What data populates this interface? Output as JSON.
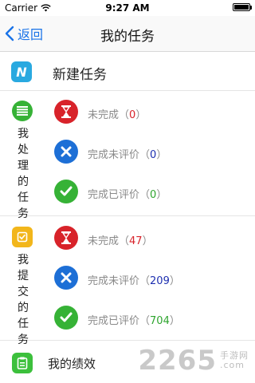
{
  "status_bar": {
    "carrier": "Carrier",
    "time": "9:27 AM",
    "battery_level": 1.0
  },
  "nav": {
    "back_label": "返回",
    "title": "我的任务"
  },
  "new_task": {
    "icon_letter": "N",
    "label": "新建任务"
  },
  "groups": [
    {
      "title": "我处理的任务",
      "icon": "list-icon",
      "items": [
        {
          "label": "未完成",
          "count": "0",
          "icon": "hourglass-icon",
          "color": "#d8232a"
        },
        {
          "label": "完成未评价",
          "count": "0",
          "icon": "x-icon",
          "color": "#1d2fb0"
        },
        {
          "label": "完成已评价",
          "count": "0",
          "icon": "check-icon",
          "color": "#2fa52f"
        }
      ]
    },
    {
      "title": "我提交的任务",
      "icon": "submit-icon",
      "items": [
        {
          "label": "未完成",
          "count": "47",
          "icon": "hourglass-icon",
          "color": "#d8232a"
        },
        {
          "label": "完成未评价",
          "count": "209",
          "icon": "x-icon",
          "color": "#1d2fb0"
        },
        {
          "label": "完成已评价",
          "count": "704",
          "icon": "check-icon",
          "color": "#2fa52f"
        }
      ]
    }
  ],
  "performance": {
    "label": "我的绩效"
  },
  "watermark": {
    "brand": "2265",
    "line1": "手游网",
    "line2": ".com"
  },
  "colors": {
    "accent": "#1a73e8",
    "red": "#d8232a",
    "blue": "#1d6fd6",
    "green": "#36b236",
    "yellow": "#f2b61b",
    "cyan": "#29a9e0"
  }
}
